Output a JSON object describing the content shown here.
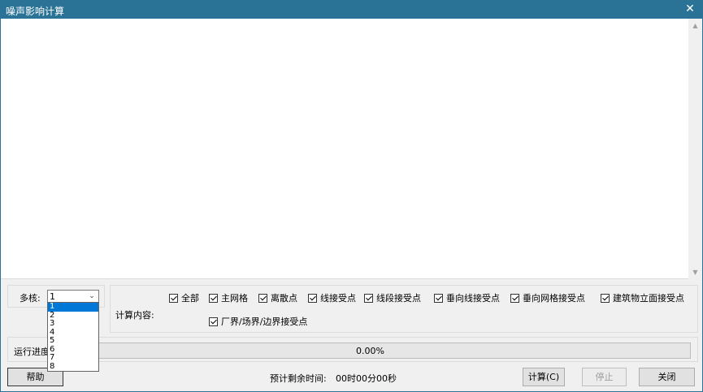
{
  "window": {
    "title": "噪声影响计算",
    "close_glyph": "✕"
  },
  "cores": {
    "label": "多核:",
    "selected": "1",
    "options": [
      "1",
      "2",
      "3",
      "4",
      "5",
      "6",
      "7",
      "8"
    ]
  },
  "calc_content": {
    "label": "计算内容:",
    "items": [
      {
        "label": "全部",
        "checked": true
      },
      {
        "label": "主网格",
        "checked": true
      },
      {
        "label": "离散点",
        "checked": true
      },
      {
        "label": "线接受点",
        "checked": true
      },
      {
        "label": "线段接受点",
        "checked": true
      },
      {
        "label": "垂向线接受点",
        "checked": true
      },
      {
        "label": "垂向网格接受点",
        "checked": true
      },
      {
        "label": "建筑物立面接受点",
        "checked": true
      },
      {
        "label": "厂界/场界/边界接受点",
        "checked": true
      }
    ]
  },
  "progress": {
    "label": "运行进度",
    "percent_text": "0.00%",
    "value": 0
  },
  "remaining": {
    "label": "预计剩余时间:",
    "value": "00时00分00秒"
  },
  "buttons": {
    "help": "帮助",
    "calc": "计算(C)",
    "stop": "停止",
    "close": "关闭"
  }
}
